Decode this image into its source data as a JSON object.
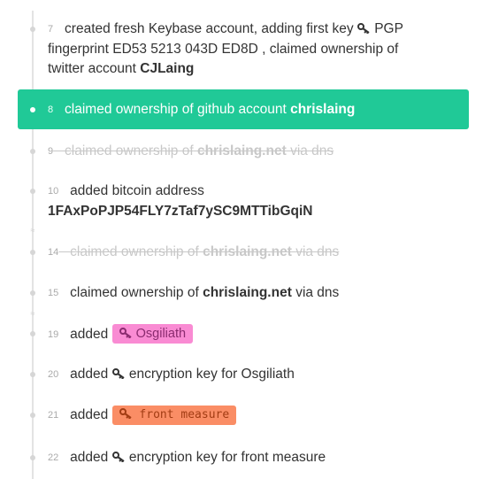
{
  "entries": [
    {
      "seq": "7",
      "text1": "created fresh Keybase account, adding first key",
      "text2": "PGP",
      "line2": "fingerprint ED53 5213 043D ED8D , claimed ownership of",
      "line3_prefix": "twitter account",
      "line3_strong": "CJLaing"
    },
    {
      "seq": "8",
      "prefix": "claimed ownership of github account",
      "strong": "chrislaing"
    },
    {
      "seq": "9",
      "prefix": "claimed ownership of",
      "strong": "chrislaing.net",
      "suffix": "via dns"
    },
    {
      "seq": "10",
      "prefix": "added bitcoin address",
      "line2_strong": "1FAxPoPJP54FLY7zTaf7ySC9MTTibGqiN"
    },
    {
      "seq": "14",
      "prefix": "claimed ownership of",
      "strong": "chrislaing.net",
      "suffix": "via dns"
    },
    {
      "seq": "15",
      "prefix": "claimed ownership of",
      "strong": "chrislaing.net",
      "suffix": "via dns"
    },
    {
      "seq": "19",
      "prefix": "added",
      "badge": "Osgiliath"
    },
    {
      "seq": "20",
      "prefix": "added",
      "suffix": "encryption key for Osgiliath"
    },
    {
      "seq": "21",
      "prefix": "added",
      "badge": "front measure"
    },
    {
      "seq": "22",
      "prefix": "added",
      "suffix": "encryption key for front measure"
    }
  ],
  "icons": {
    "key": "key-icon",
    "collapse": "chevron-collapse-icon"
  },
  "colors": {
    "highlight": "#20c997",
    "badge_pink": "#f98bd3",
    "badge_orange": "#fa8d65"
  }
}
